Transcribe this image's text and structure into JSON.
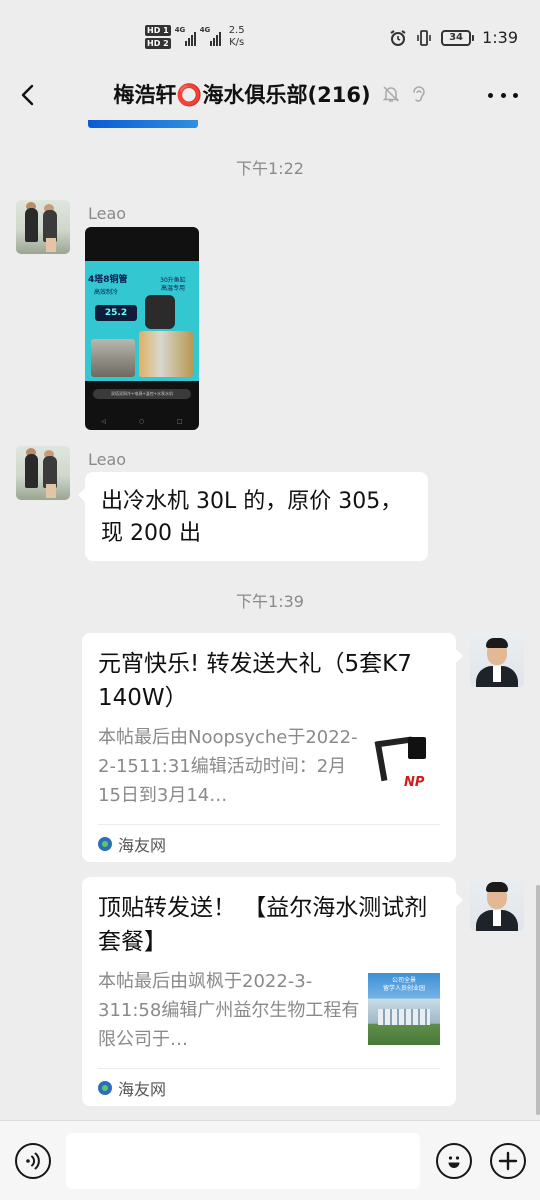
{
  "status_bar": {
    "hd1": "HD 1",
    "hd2": "HD 2",
    "net1": "4G",
    "net2": "4G",
    "speed_value": "2.5",
    "speed_unit": "K/s",
    "battery": "34",
    "time": "1:39"
  },
  "header": {
    "back_icon": "chevron-left-icon",
    "title": "梅浩轩⭕海水俱乐部(216)",
    "mute_icon": "bell-muted-icon",
    "ear_icon": "ear-icon",
    "more_icon": "more-dots-icon"
  },
  "messages": {
    "stamp1": "下午1:22",
    "msg1": {
      "sender": "Leao",
      "image": {
        "headline": "4塔8铜管",
        "headline_sub": "高效制冷",
        "tag": "30升鱼缸\n高温专用",
        "lcd": "25.2",
        "caption": "双塔双铜冷+电源+温控+水泵水机"
      }
    },
    "msg2": {
      "sender": "Leao",
      "text": "出冷水机 30L 的，原价 305，现 200 出"
    },
    "stamp2": "下午1:39",
    "card1": {
      "title": "元宵快乐! 转发送大礼（5套K7 140W）",
      "desc": "本帖最后由Noopsyche于2022-2-1511:31编辑活动时间：2月15日到3月14…",
      "thumb_logo": "NP",
      "source": "海友网"
    },
    "card2": {
      "title": "顶贴转发送！ 【益尔海水测试剂套餐】",
      "desc": "本帖最后由飒枫于2022-3-311:58编辑广州益尔生物工程有限公司于…",
      "thumb_text": "公司全景\n留学人员创业园",
      "source": "海友网"
    }
  },
  "input_bar": {
    "voice_icon": "voice-icon",
    "emoji_icon": "emoji-icon",
    "plus_icon": "plus-icon",
    "input_value": ""
  }
}
